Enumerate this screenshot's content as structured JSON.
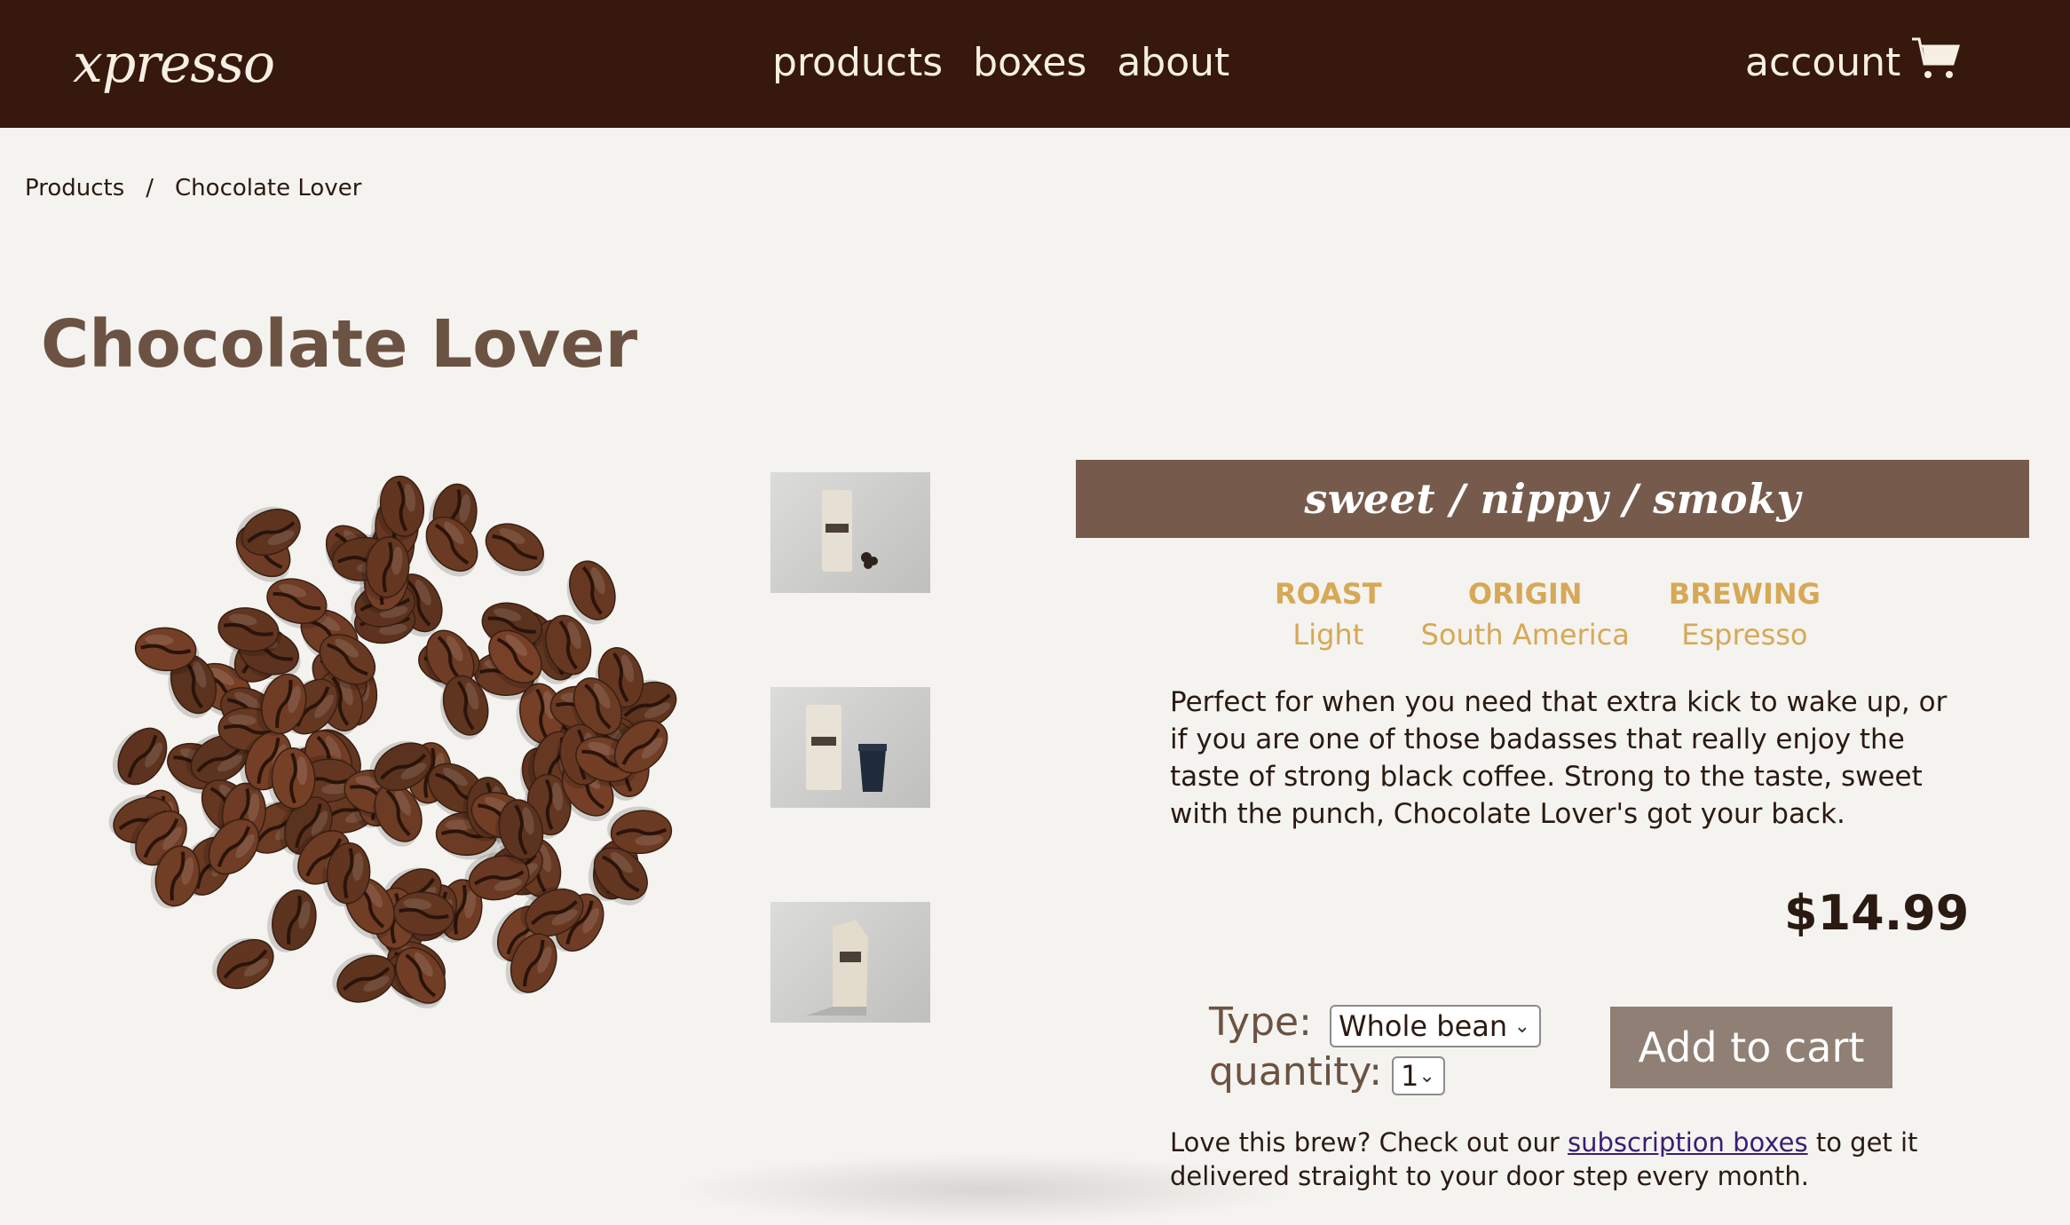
{
  "header": {
    "logo": "xpresso",
    "nav": [
      "products",
      "boxes",
      "about"
    ],
    "account": "account",
    "cart_icon": "shopping-cart-icon"
  },
  "breadcrumb": {
    "items": [
      "Products",
      "Chocolate Lover"
    ],
    "separator": "/"
  },
  "product": {
    "title": "Chocolate Lover",
    "flavor": "sweet / nippy / smoky",
    "specs": [
      {
        "label": "ROAST",
        "value": "Light"
      },
      {
        "label": "ORIGIN",
        "value": "South America"
      },
      {
        "label": "BREWING",
        "value": "Espresso"
      }
    ],
    "description": "Perfect for when you need that extra kick to wake up, or if you are one of those badasses that really enjoy the taste of strong black coffee. Strong to the taste, sweet with the punch, Chocolate Lover's got your back.",
    "price": "$14.99",
    "type_label": "Type:",
    "type_value": "Whole bean",
    "quantity_label": "quantity:",
    "quantity_value": "1",
    "add_to_cart": "Add to cart"
  },
  "promo": {
    "before": "Love this brew? Check out our ",
    "link": "subscription boxes",
    "after": " to get it delivered straight to your door step every month."
  },
  "colors": {
    "header_bg": "#36190c",
    "flavor_bar": "#765b4c",
    "spec_text": "#d6a857",
    "button_bg": "#8f7f74",
    "title": "#6c5243"
  }
}
